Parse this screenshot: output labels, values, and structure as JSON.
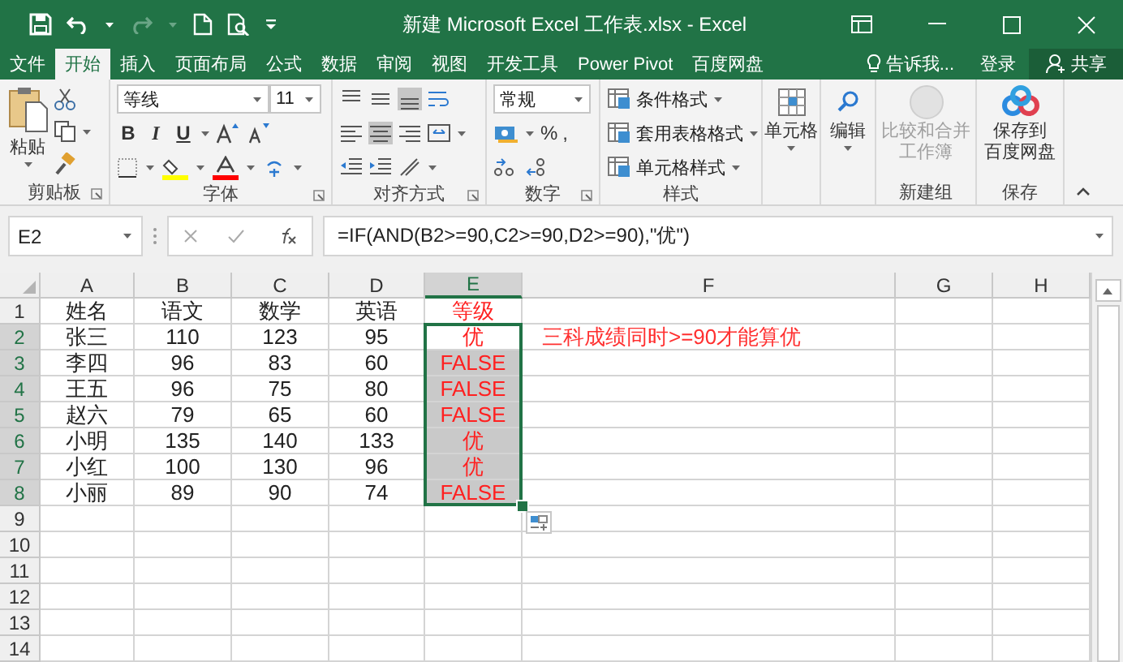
{
  "window": {
    "title": "新建 Microsoft Excel 工作表.xlsx - Excel"
  },
  "tabs": [
    {
      "label": "文件",
      "selected": false
    },
    {
      "label": "开始",
      "selected": true
    },
    {
      "label": "插入",
      "selected": false
    },
    {
      "label": "页面布局",
      "selected": false
    },
    {
      "label": "公式",
      "selected": false
    },
    {
      "label": "数据",
      "selected": false
    },
    {
      "label": "审阅",
      "selected": false
    },
    {
      "label": "视图",
      "selected": false
    },
    {
      "label": "开发工具",
      "selected": false
    },
    {
      "label": "Power Pivot",
      "selected": false
    },
    {
      "label": "百度网盘",
      "selected": false
    }
  ],
  "tell_me": "告诉我...",
  "sign_in": "登录",
  "share": "共享",
  "ribbon": {
    "clipboard": {
      "paste": "粘贴",
      "label": "剪贴板"
    },
    "font": {
      "name": "等线",
      "size": "11",
      "bold": "B",
      "italic": "I",
      "underline": "U",
      "label": "字体"
    },
    "alignment": {
      "label": "对齐方式"
    },
    "number": {
      "format": "常规",
      "percent": "%",
      "comma": ",",
      "label": "数字"
    },
    "styles": {
      "items": [
        "条件格式",
        "套用表格格式",
        "单元格样式"
      ],
      "label": "样式"
    },
    "cells": {
      "button": "单元格"
    },
    "editing": {
      "button": "编辑"
    },
    "compare": {
      "lines": [
        "比较和合并",
        "工作簿"
      ],
      "disabled": true,
      "label": "新建组"
    },
    "save": {
      "lines": [
        "保存到",
        "百度网盘"
      ],
      "label": "保存"
    }
  },
  "formula_bar": {
    "name_box": "E2",
    "formula": "=IF(AND(B2>=90,C2>=90,D2>=90),\"优\")"
  },
  "sheet": {
    "columns": [
      {
        "label": "A",
        "selected": false
      },
      {
        "label": "B",
        "selected": false
      },
      {
        "label": "C",
        "selected": false
      },
      {
        "label": "D",
        "selected": false
      },
      {
        "label": "E",
        "selected": true
      },
      {
        "label": "F",
        "selected": false
      },
      {
        "label": "G",
        "selected": false
      },
      {
        "label": "H",
        "selected": false
      }
    ],
    "rows": [
      {
        "number": "1",
        "name": "姓名",
        "scores": [
          "语文",
          "数学",
          "英语"
        ],
        "grade": "等级",
        "selected": false
      },
      {
        "number": "2",
        "name": "张三",
        "scores": [
          "110",
          "123",
          "95"
        ],
        "grade": "优",
        "selected": true,
        "note": "三科成绩同时>=90才能算优"
      },
      {
        "number": "3",
        "name": "李四",
        "scores": [
          "96",
          "83",
          "60"
        ],
        "grade": "FALSE",
        "selected": true
      },
      {
        "number": "4",
        "name": "王五",
        "scores": [
          "96",
          "75",
          "80"
        ],
        "grade": "FALSE",
        "selected": true
      },
      {
        "number": "5",
        "name": "赵六",
        "scores": [
          "79",
          "65",
          "60"
        ],
        "grade": "FALSE",
        "selected": true
      },
      {
        "number": "6",
        "name": "小明",
        "scores": [
          "135",
          "140",
          "133"
        ],
        "grade": "优",
        "selected": true
      },
      {
        "number": "7",
        "name": "小红",
        "scores": [
          "100",
          "130",
          "96"
        ],
        "grade": "优",
        "selected": true
      },
      {
        "number": "8",
        "name": "小丽",
        "scores": [
          "89",
          "90",
          "74"
        ],
        "grade": "FALSE",
        "selected": true
      },
      {
        "number": "9",
        "selected": false
      },
      {
        "number": "10",
        "selected": false
      },
      {
        "number": "11",
        "selected": false
      },
      {
        "number": "12",
        "selected": false
      },
      {
        "number": "13",
        "selected": false
      },
      {
        "number": "14",
        "selected": false
      }
    ]
  }
}
